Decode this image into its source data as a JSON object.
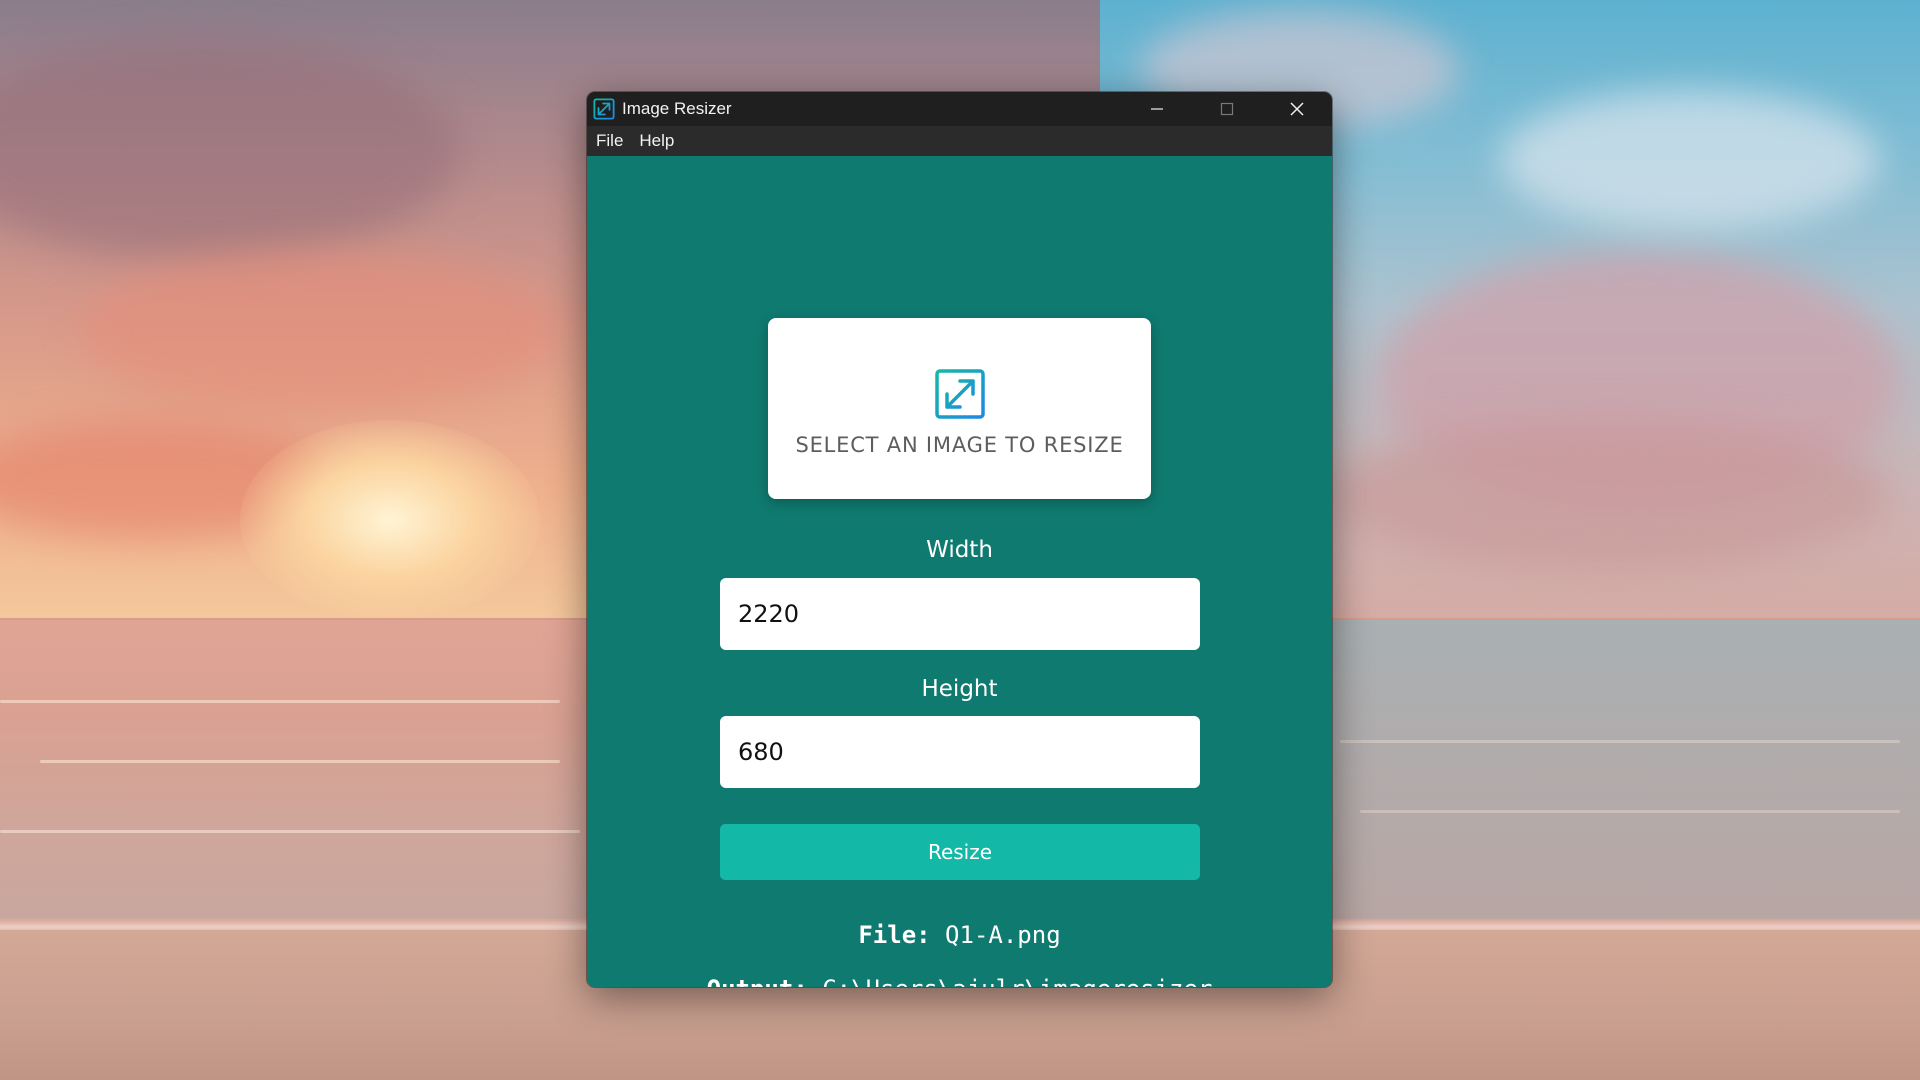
{
  "window": {
    "title": "Image Resizer",
    "controls": {
      "minimize": "minimize-icon",
      "maximize": "maximize-icon",
      "close": "close-icon"
    }
  },
  "menu": {
    "items": [
      "File",
      "Help"
    ]
  },
  "dropzone": {
    "icon": "expand-arrows-icon",
    "text": "SELECT AN IMAGE TO RESIZE"
  },
  "form": {
    "width_label": "Width",
    "width_value": "2220",
    "height_label": "Height",
    "height_value": "680",
    "resize_label": "Resize"
  },
  "info": {
    "file_key": "File:",
    "file_value": "Q1-A.png",
    "output_key": "Output:",
    "output_value": "C:\\Users\\ajulr\\imageresizer"
  },
  "colors": {
    "window_bg": "#0f7a70",
    "titlebar_bg": "#1f1f1f",
    "menubar_bg": "#2b2b2b",
    "accent_button": "#14b8a6",
    "icon_gradient_start": "#14b8a6",
    "icon_gradient_end": "#1e88e5"
  }
}
